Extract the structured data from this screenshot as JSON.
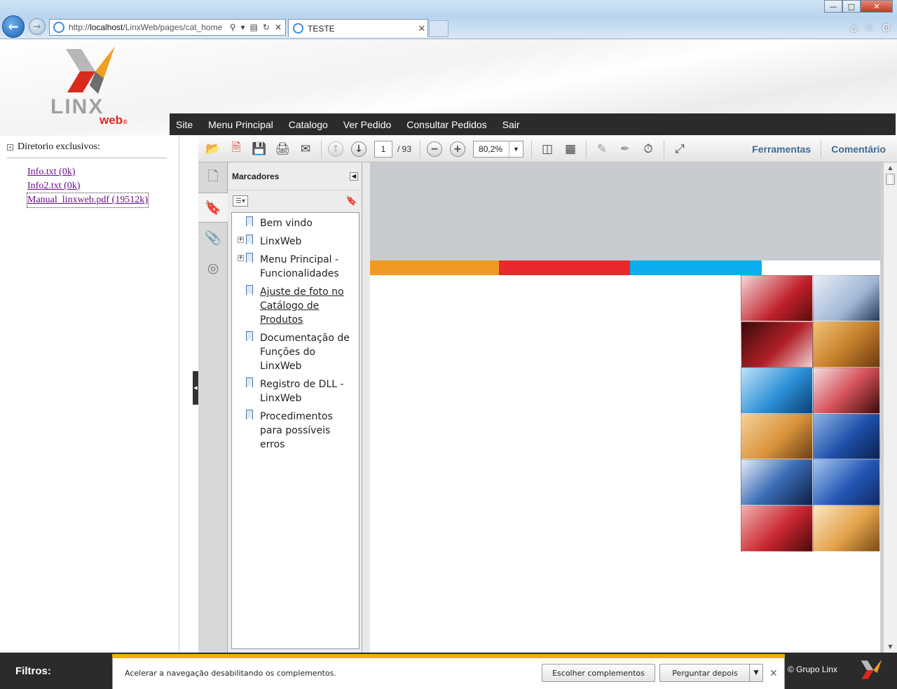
{
  "browser": {
    "address_plain_prefix": "http://",
    "address_host": "localhost",
    "address_path": "/LinxWeb/pages/cat_home",
    "tab_title": "TESTE",
    "back_icon": "back-arrow-icon",
    "forward_icon": "forward-arrow-icon",
    "window_buttons": [
      "minimize",
      "maximize",
      "close"
    ]
  },
  "header": {
    "logo_text": "LINX",
    "logo_subtext": "web",
    "menu": [
      "Site",
      "Menu Principal",
      "Catalogo",
      "Ver Pedido",
      "Consultar Pedidos",
      "Sair"
    ]
  },
  "sidebar": {
    "title": "Diretorio exclusivos:",
    "files": [
      "Info.txt (0k)",
      "Info2.txt (0k)",
      "Manual_linxweb.pdf (19512k)"
    ]
  },
  "pdf": {
    "page_current": "1",
    "page_total": "/ 93",
    "zoom": "80,2%",
    "tools_label": "Ferramentas",
    "comment_label": "Comentário",
    "bookmarks_title": "Marcadores",
    "bookmarks": [
      {
        "label": "Bem vindo",
        "expandable": false,
        "underline": false
      },
      {
        "label": "LinxWeb",
        "expandable": true,
        "underline": false
      },
      {
        "label": "Menu Principal - Funcionalidades",
        "expandable": true,
        "underline": false
      },
      {
        "label": "Ajuste de foto no Catálogo de Produtos",
        "expandable": false,
        "underline": true
      },
      {
        "label": "Documentação de Funções do LinxWeb",
        "expandable": false,
        "underline": false
      },
      {
        "label": "Registro de DLL - LinxWeb",
        "expandable": false,
        "underline": false
      },
      {
        "label": "Procedimentos para possíveis erros",
        "expandable": false,
        "underline": false
      }
    ],
    "stripe_colors": [
      "#f19a22",
      "#e8282c",
      "#0aaeef"
    ]
  },
  "footer": {
    "filters_label": "Filtros:",
    "copyright": "© Grupo Linx"
  },
  "notification": {
    "text": "Acelerar a navegação desabilitando os complementos.",
    "choose_button": "Escolher complementos",
    "later_button": "Perguntar depois"
  }
}
